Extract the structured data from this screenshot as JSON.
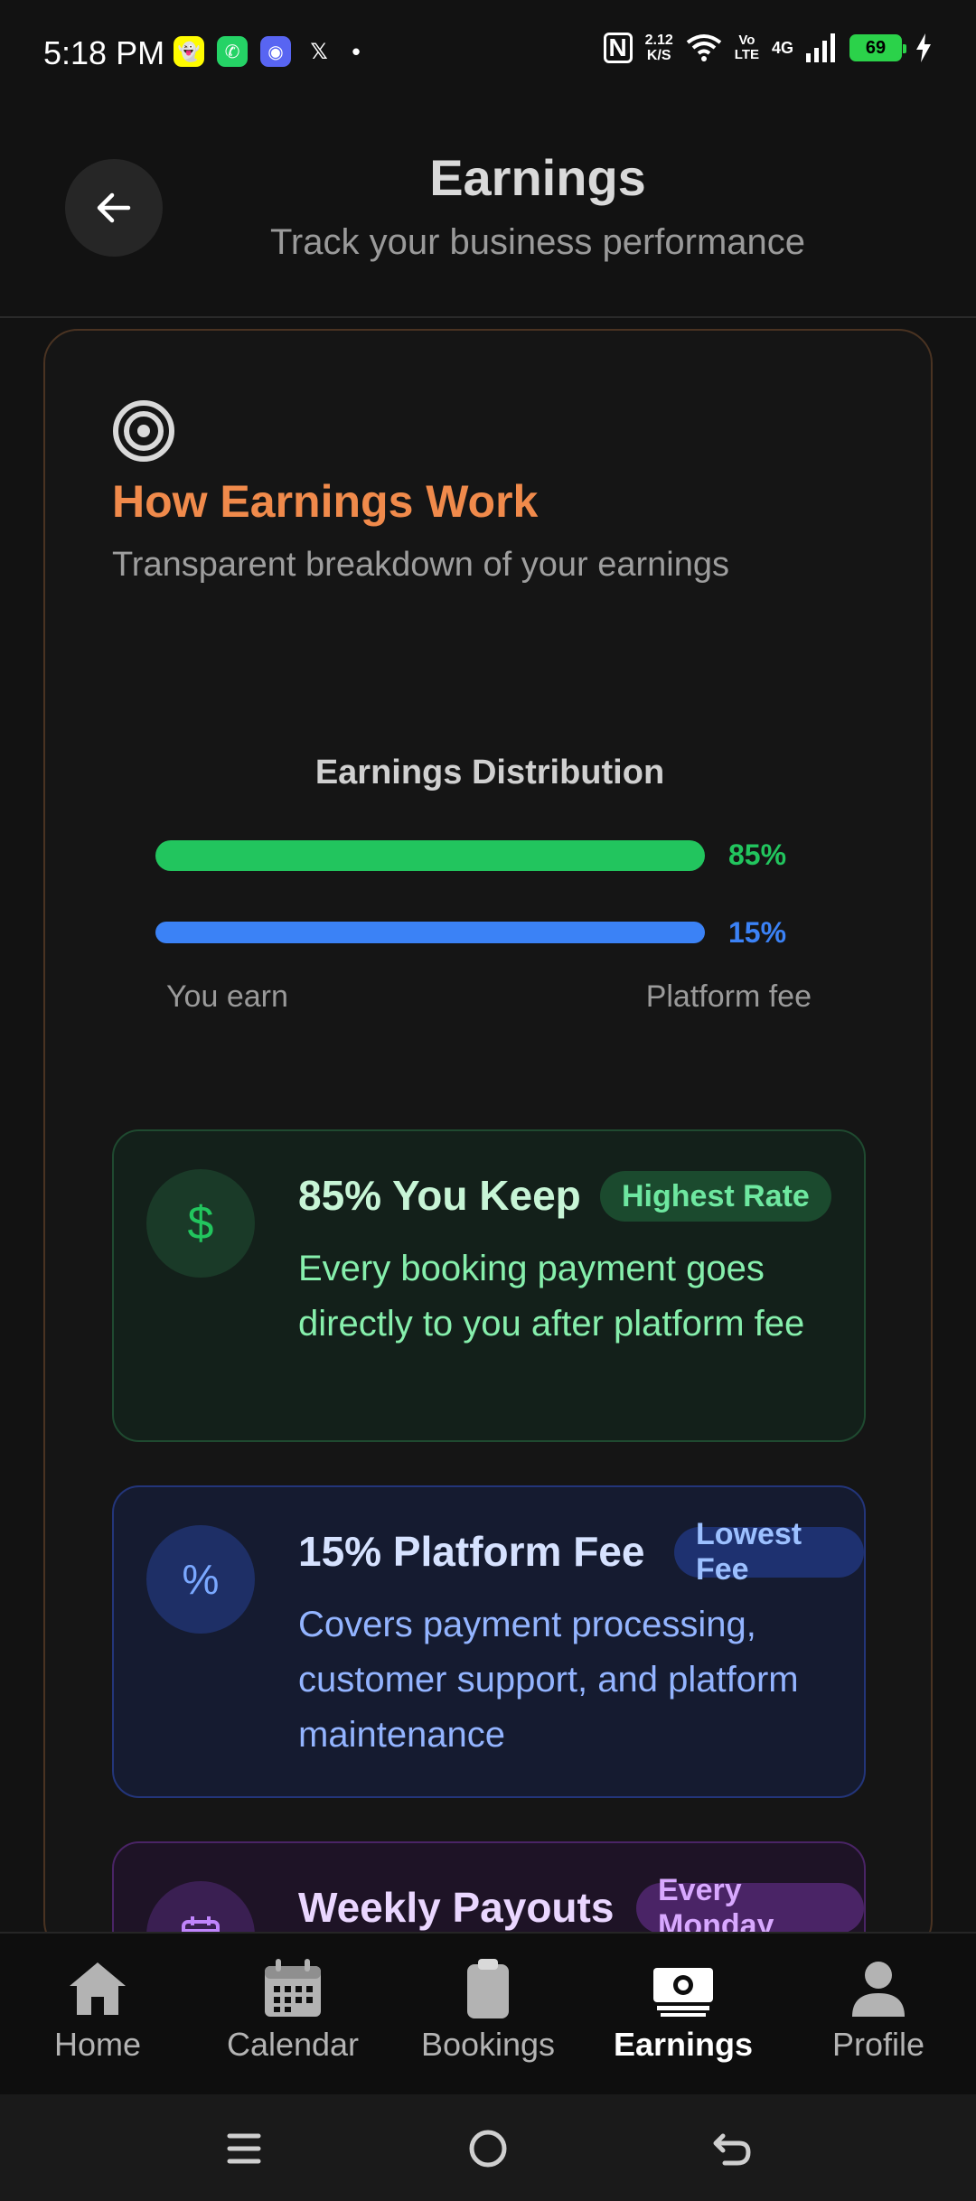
{
  "status_bar": {
    "time": "5:18 PM",
    "notification_icons": [
      "snapchat-icon",
      "whatsapp-icon",
      "discord-icon",
      "x-icon",
      "dot-icon"
    ],
    "network_speed": "2.12\nK/S",
    "volte": "Vo\nLTE",
    "network_type": "4G",
    "battery": "69"
  },
  "header": {
    "title": "Earnings",
    "subtitle": "Track your business performance"
  },
  "card": {
    "title": "How Earnings Work",
    "subtitle": "Transparent breakdown of your earnings",
    "distribution": {
      "title": "Earnings Distribution",
      "you_earn_pct": "85%",
      "platform_fee_pct": "15%",
      "you_earn_value": 0.85,
      "platform_fee_value": 0.15,
      "legend_left": "You earn",
      "legend_right": "Platform fee"
    },
    "items": [
      {
        "icon": "dollar-icon",
        "title": "85% You Keep",
        "badge": "Highest Rate",
        "description": "Every booking payment goes directly to you after platform fee"
      },
      {
        "icon": "percent-icon",
        "title": "15% Platform Fee",
        "badge": "Lowest Fee",
        "description": "Covers payment processing, customer support, and platform maintenance"
      },
      {
        "icon": "calendar-icon",
        "title": "Weekly Payouts",
        "badge": "Every Monday",
        "description": ""
      }
    ]
  },
  "bottom_nav": {
    "items": [
      {
        "label": "Home",
        "icon": "home-icon",
        "active": false
      },
      {
        "label": "Calendar",
        "icon": "calendar-icon",
        "active": false
      },
      {
        "label": "Bookings",
        "icon": "clipboard-icon",
        "active": false
      },
      {
        "label": "Earnings",
        "icon": "cash-icon",
        "active": true
      },
      {
        "label": "Profile",
        "icon": "person-icon",
        "active": false
      }
    ]
  },
  "colors": {
    "accent_orange": "#f08a4b",
    "earn_green": "#22c55e",
    "fee_blue": "#3b82f6"
  }
}
